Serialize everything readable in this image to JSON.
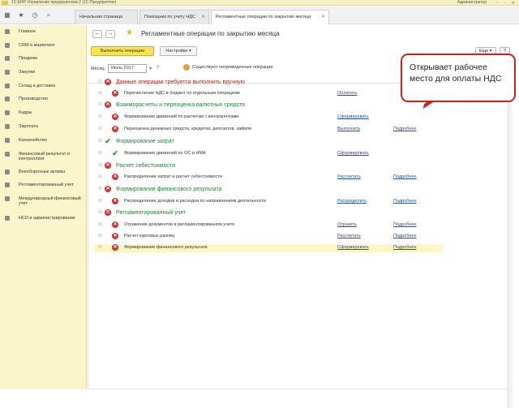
{
  "window": {
    "title": "1С:ERP Управление предприятием 2 (1С:Предприятие)",
    "user": "Администратор"
  },
  "tabs": [
    {
      "label": "Начальная страница"
    },
    {
      "label": "Помощник по учету НДС"
    },
    {
      "label": "Регламентные операции по закрытию месяца"
    }
  ],
  "sidebar": {
    "items": [
      {
        "label": "Главное"
      },
      {
        "label": "CRM и маркетинг"
      },
      {
        "label": "Продажи"
      },
      {
        "label": "Закупки"
      },
      {
        "label": "Склад и доставка"
      },
      {
        "label": "Производство"
      },
      {
        "label": "Кадры"
      },
      {
        "label": "Зарплата"
      },
      {
        "label": "Казначейство"
      },
      {
        "label": "Финансовый результат и контроллинг"
      },
      {
        "label": "Внеоборотные активы"
      },
      {
        "label": "Регламентированный учет"
      },
      {
        "label": "Международный финансовый учет"
      },
      {
        "label": "НСИ и администрирование"
      }
    ]
  },
  "page": {
    "title": "Регламентные операции по закрытию месяца",
    "run_button": "Выполнить операции",
    "settings_button": "Настройки",
    "more_button": "Еще",
    "help_button": "?",
    "month_label": "Месяц:",
    "month_value": "Июль 2017",
    "unposted": "Существуют непроведенные операции"
  },
  "sections": [
    {
      "title": "Данные операции требуется выполнить вручную",
      "color": "#c52020",
      "status": "error",
      "ops": [
        {
          "label": "Перечисление НДС в бюджет по отдельным операциям",
          "action": "Оплатить",
          "more": ""
        }
      ]
    },
    {
      "title": "Взаиморасчеты и переоценка валютных средств",
      "color": "#1e8a3a",
      "status": "error",
      "ops": [
        {
          "label": "Формирование движений по расчетам с контрагентами",
          "action": "Сформировать",
          "more": ""
        },
        {
          "label": "Переоценка денежных средств, кредитов, депозитов, займов",
          "action": "Выполнить",
          "more": "Подробнее"
        }
      ]
    },
    {
      "title": "Формирование затрат",
      "color": "#1e8a3a",
      "status": "ok",
      "ops": [
        {
          "label": "Формирование движений по ОС и НМА",
          "action": "Сформировать",
          "more": ""
        }
      ]
    },
    {
      "title": "Расчет себестоимости",
      "color": "#1e8a3a",
      "status": "error",
      "ops": [
        {
          "label": "Распределение затрат и расчет себестоимости",
          "action": "Рассчитать",
          "more": "Подробнее"
        }
      ]
    },
    {
      "title": "Формирование финансового результата",
      "color": "#1e8a3a",
      "status": "error",
      "ops": [
        {
          "label": "Распределение доходов и расходов по направлениям деятельности",
          "action": "Распределить",
          "more": "Подробнее"
        }
      ]
    },
    {
      "title": "Регламентированный учет",
      "color": "#1e8a3a",
      "status": "error",
      "ops": [
        {
          "label": "Отражение документов в регламентированном учете",
          "action": "Отразить",
          "more": "Подробнее"
        },
        {
          "label": "Расчет курсовых разниц",
          "action": "Рассчитать",
          "more": "Подробнее"
        },
        {
          "label": "Формирование финансового результата",
          "action": "Сформировать",
          "more": "Подробнее",
          "highlight": true
        }
      ]
    }
  ],
  "callout": {
    "text": "Открывает рабочее место для оплаты НДС"
  }
}
